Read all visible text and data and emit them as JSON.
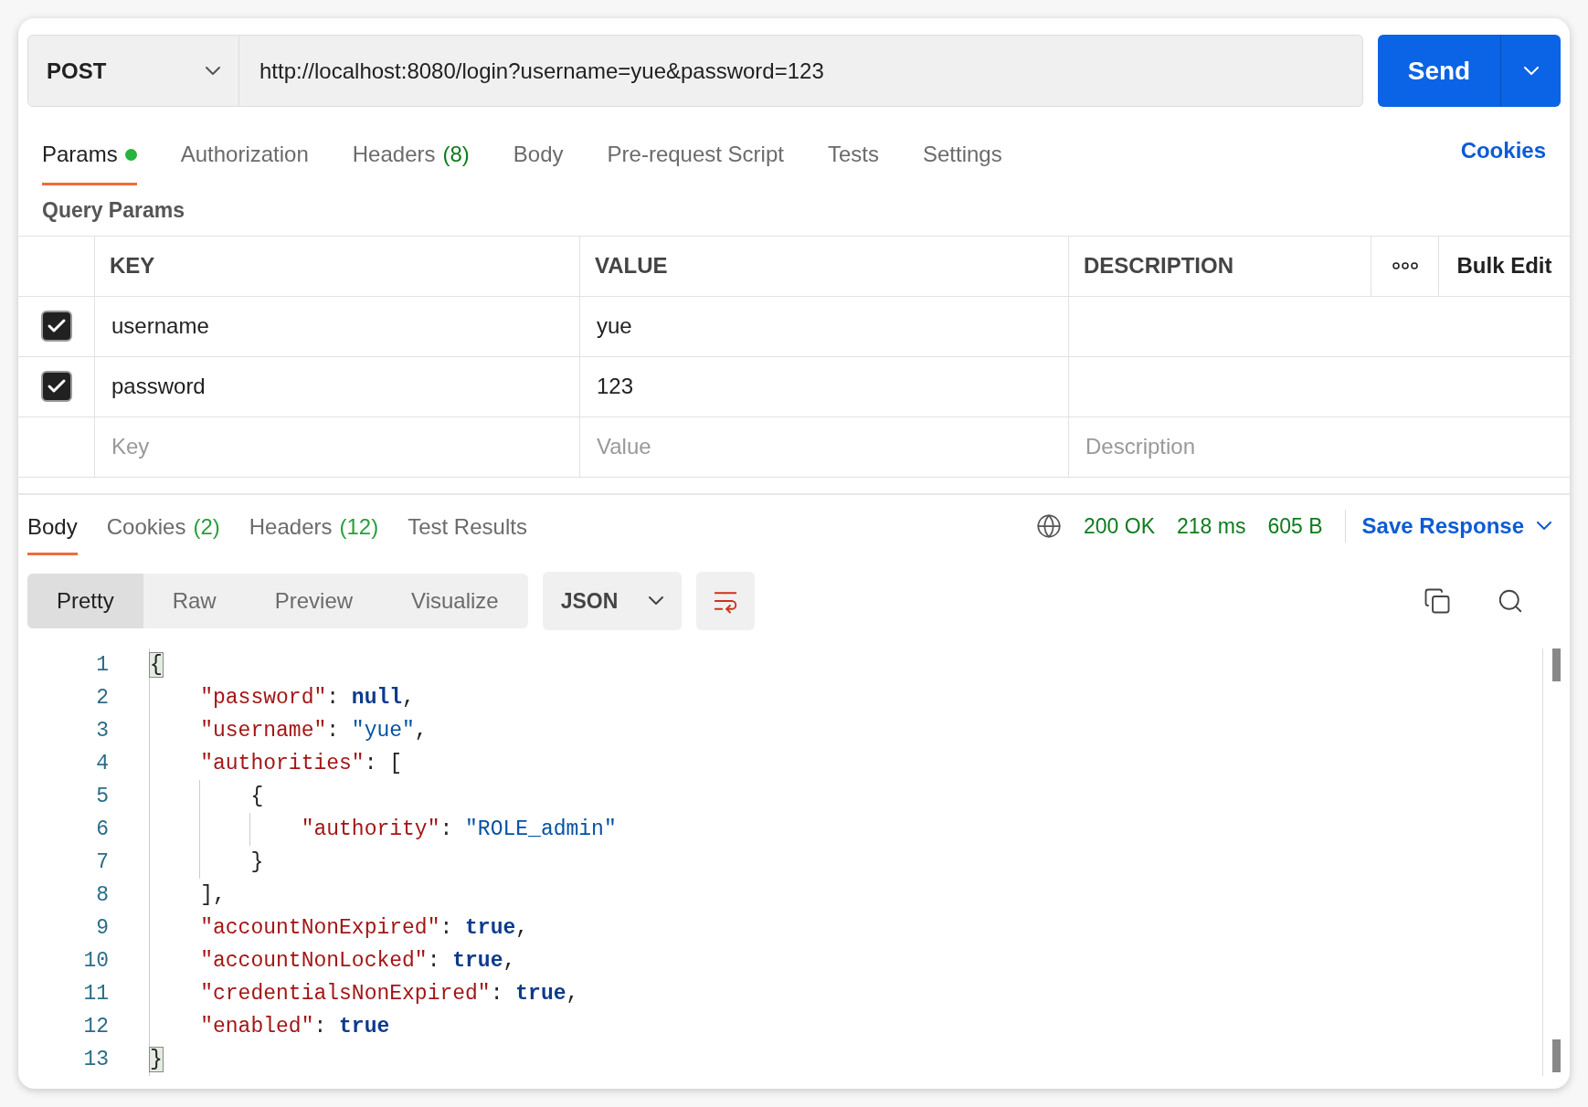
{
  "request": {
    "method": "POST",
    "url": "http://localhost:8080/login?username=yue&password=123",
    "send_label": "Send"
  },
  "request_tabs": [
    {
      "label": "Params",
      "dot": true,
      "selected": true
    },
    {
      "label": "Authorization",
      "dot": false,
      "selected": false
    },
    {
      "label": "Headers",
      "count": "(8)",
      "dot": false,
      "selected": false
    },
    {
      "label": "Body",
      "dot": false,
      "selected": false
    },
    {
      "label": "Pre-request Script",
      "dot": false,
      "selected": false
    },
    {
      "label": "Tests",
      "dot": false,
      "selected": false
    },
    {
      "label": "Settings",
      "dot": false,
      "selected": false
    }
  ],
  "cookies_link": "Cookies",
  "query_params": {
    "title": "Query Params",
    "columns": [
      "KEY",
      "VALUE",
      "DESCRIPTION"
    ],
    "bulk_edit": "Bulk Edit",
    "rows": [
      {
        "checked": true,
        "key": "username",
        "value": "yue"
      },
      {
        "checked": true,
        "key": "password",
        "value": "123"
      }
    ],
    "new_row": {
      "key": {
        "placeholder": "Key"
      },
      "value": {
        "placeholder": "Value"
      },
      "description": {
        "placeholder": "Description"
      }
    }
  },
  "response_tabs": [
    {
      "label": "Body",
      "selected": true
    },
    {
      "label": "Cookies",
      "count": "(2)",
      "selected": false
    },
    {
      "label": "Headers",
      "count": "(12)",
      "selected": false
    },
    {
      "label": "Test Results",
      "selected": false
    }
  ],
  "status": {
    "code": "200 OK",
    "time": "218 ms",
    "size": "605 B",
    "save": "Save Response"
  },
  "formats": [
    {
      "label": "Pretty",
      "selected": true
    },
    {
      "label": "Raw",
      "selected": false
    },
    {
      "label": "Preview",
      "selected": false
    },
    {
      "label": "Visualize",
      "selected": false
    }
  ],
  "language": "JSON",
  "wrap_lines": true,
  "code": [
    {
      "number": "1",
      "tokens": [
        {
          "kind": "match",
          "text": "{"
        }
      ]
    },
    {
      "number": "2",
      "tokens": [
        {
          "kind": "key",
          "text": "    \"password\""
        },
        {
          "kind": "punct",
          "text": ": "
        },
        {
          "kind": "keyword",
          "text": "null"
        },
        {
          "kind": "punct",
          "text": ","
        }
      ]
    },
    {
      "number": "3",
      "tokens": [
        {
          "kind": "key",
          "text": "    \"username\""
        },
        {
          "kind": "punct",
          "text": ": "
        },
        {
          "kind": "string",
          "text": "\"yue\""
        },
        {
          "kind": "punct",
          "text": ","
        }
      ]
    },
    {
      "number": "4",
      "tokens": [
        {
          "kind": "key",
          "text": "    \"authorities\""
        },
        {
          "kind": "punct",
          "text": ": ["
        }
      ]
    },
    {
      "number": "5",
      "tokens": [
        {
          "kind": "punct",
          "text": "        {"
        }
      ]
    },
    {
      "number": "6",
      "tokens": [
        {
          "kind": "key",
          "text": "            \"authority\""
        },
        {
          "kind": "punct",
          "text": ": "
        },
        {
          "kind": "string",
          "text": "\"ROLE_admin\""
        }
      ]
    },
    {
      "number": "7",
      "tokens": [
        {
          "kind": "punct",
          "text": "        }"
        }
      ]
    },
    {
      "number": "8",
      "tokens": [
        {
          "kind": "punct",
          "text": "    ],"
        }
      ]
    },
    {
      "number": "9",
      "tokens": [
        {
          "kind": "key",
          "text": "    \"accountNonExpired\""
        },
        {
          "kind": "punct",
          "text": ": "
        },
        {
          "kind": "keyword",
          "text": "true"
        },
        {
          "kind": "punct",
          "text": ","
        }
      ]
    },
    {
      "number": "10",
      "tokens": [
        {
          "kind": "key",
          "text": "    \"accountNonLocked\""
        },
        {
          "kind": "punct",
          "text": ": "
        },
        {
          "kind": "keyword",
          "text": "true"
        },
        {
          "kind": "punct",
          "text": ","
        }
      ]
    },
    {
      "number": "11",
      "tokens": [
        {
          "kind": "key",
          "text": "    \"credentialsNonExpired\""
        },
        {
          "kind": "punct",
          "text": ": "
        },
        {
          "kind": "keyword",
          "text": "true"
        },
        {
          "kind": "punct",
          "text": ","
        }
      ]
    },
    {
      "number": "12",
      "tokens": [
        {
          "kind": "key",
          "text": "    \"enabled\""
        },
        {
          "kind": "punct",
          "text": ": "
        },
        {
          "kind": "keyword",
          "text": "true"
        }
      ]
    },
    {
      "number": "13",
      "tokens": [
        {
          "kind": "match",
          "text": "}"
        }
      ]
    }
  ]
}
